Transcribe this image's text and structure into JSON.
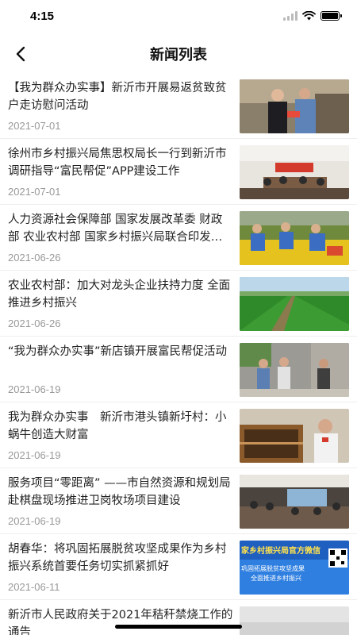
{
  "status_bar": {
    "time": "4:15"
  },
  "nav": {
    "title": "新闻列表"
  },
  "news": [
    {
      "title": "【我为群众办实事】新沂市开展易返贫致贫户走访慰问活动",
      "date": "2021-07-01"
    },
    {
      "title": "徐州市乡村振兴局焦思权局长一行到新沂市调研指导“富民帮促”APP建设工作",
      "date": "2021-07-01"
    },
    {
      "title": "人力资源社会保障部 国家发展改革委 财政部 农业农村部 国家乡村振兴局联合印发通知",
      "date": "2021-06-26"
    },
    {
      "title": "农业农村部：加大对龙头企业扶持力度 全面推进乡村振兴",
      "date": "2021-06-26"
    },
    {
      "title": "“我为群众办实事”新店镇开展富民帮促活动",
      "date": "2021-06-19"
    },
    {
      "title": "我为群众办实事　新沂市港头镇新圩村：小蜗牛创造大财富",
      "date": "2021-06-19"
    },
    {
      "title": "服务项目“零距离” ——市自然资源和规划局赴棋盘现场推进卫岗牧场项目建设",
      "date": "2021-06-19"
    },
    {
      "title": "胡春华：将巩固拓展脱贫攻坚成果作为乡村振兴系统首要任务切实抓紧抓好",
      "date": "2021-06-11"
    },
    {
      "title": "新沂市人民政府关于2021年秸秆禁烧工作的通告",
      "date": ""
    }
  ],
  "thumb8": {
    "line1": "家乡村振兴局官方微信",
    "line2": "巩固拓展脱贫攻坚成果",
    "line3": "全面推进乡村振兴"
  },
  "colors": {
    "accent_blue": "#1f5fbf",
    "text": "#222222",
    "date": "#999999"
  }
}
